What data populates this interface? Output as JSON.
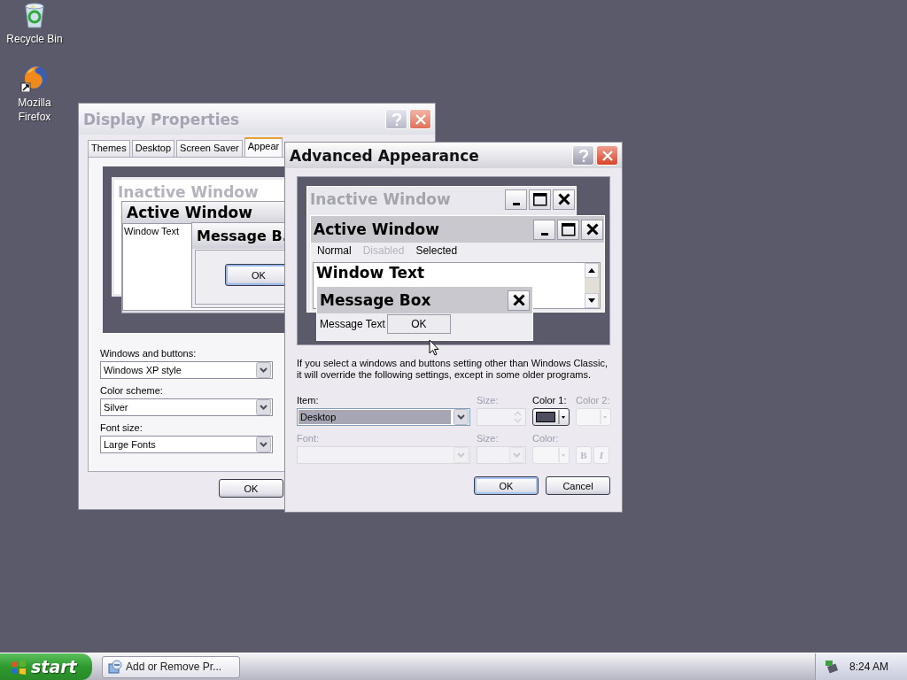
{
  "desktop_icons": [
    {
      "label": "Recycle Bin",
      "kind": "recycle_bin"
    },
    {
      "label": "Mozilla Firefox",
      "kind": "browser"
    }
  ],
  "display_properties": {
    "title": "Display Properties",
    "active": false,
    "tabs": [
      {
        "label": "Themes",
        "selected": false
      },
      {
        "label": "Desktop",
        "selected": false
      },
      {
        "label": "Screen Saver",
        "selected": false
      },
      {
        "label": "Appear",
        "selected": true
      }
    ],
    "preview": {
      "inactive_title": "Inactive Window",
      "active_title": "Active Window",
      "window_text": "Window Text",
      "message_title": "Message B.",
      "message_button": "OK"
    },
    "fields": [
      {
        "label": "Windows and buttons:",
        "value": "Windows XP style"
      },
      {
        "label": "Color scheme:",
        "value": "Silver"
      },
      {
        "label": "Font size:",
        "value": "Large Fonts"
      }
    ],
    "buttons": [
      "OK"
    ]
  },
  "advanced_appearance": {
    "title": "Advanced Appearance",
    "active": true,
    "preview": {
      "inactive_title": "Inactive Window",
      "active_title": "Active Window",
      "menu": [
        {
          "label": "Normal",
          "disabled": false
        },
        {
          "label": "Disabled",
          "disabled": true
        },
        {
          "label": "Selected",
          "disabled": false
        }
      ],
      "window_text": "Window Text",
      "message_title": "Message Box",
      "message_text": "Message Text",
      "message_button": "OK"
    },
    "note": "If you select a windows and buttons setting other than Windows Classic, it will override the following settings, except in some older programs.",
    "rows": [
      [
        {
          "kind": "dropdown",
          "label": "Item:",
          "value": "Desktop",
          "disabled": false
        },
        {
          "kind": "spinner",
          "label": "Size:",
          "disabled": true
        },
        {
          "kind": "color",
          "label": "Color 1:",
          "color": "#4f4e5e",
          "disabled": false
        },
        {
          "kind": "color",
          "label": "Color 2:",
          "disabled": true
        }
      ],
      [
        {
          "kind": "dropdown",
          "label": "Font:",
          "disabled": true
        },
        {
          "kind": "dropdown",
          "label": "Size:",
          "disabled": true
        },
        {
          "kind": "color",
          "label": "Color:",
          "disabled": true
        },
        {
          "kind": "style_buttons",
          "buttons": [
            "B",
            "I"
          ],
          "disabled": true
        }
      ]
    ],
    "buttons": [
      {
        "label": "OK",
        "default": true
      },
      {
        "label": "Cancel",
        "default": false
      }
    ]
  },
  "taskbar": {
    "start": "start",
    "tasks": [
      {
        "label": "Add or Remove Pr...",
        "selected": false
      }
    ],
    "clock": "8:24 AM"
  }
}
